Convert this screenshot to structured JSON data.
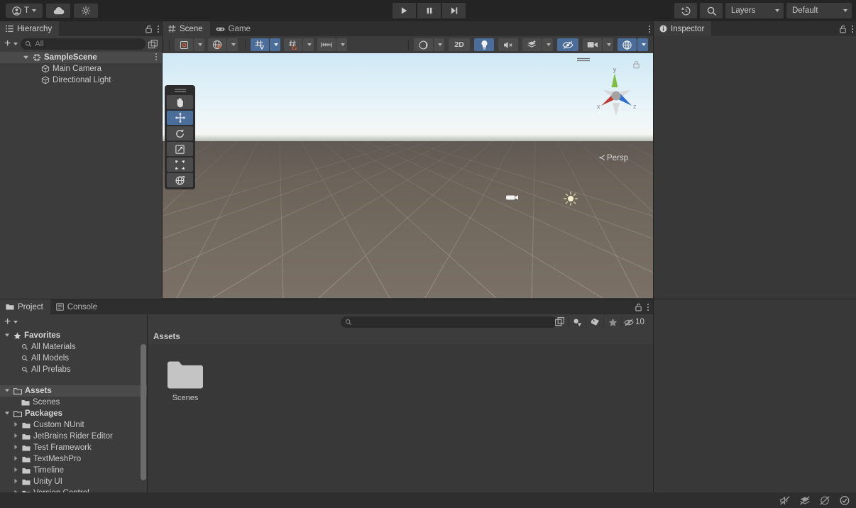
{
  "topbar": {
    "account_label": "T",
    "account_icon": "user-icon",
    "cloud_icon": "cloud-icon",
    "settings_icon": "settings-gear-icon",
    "play_icon": "play-icon",
    "pause_icon": "pause-icon",
    "step_icon": "step-icon",
    "history_icon": "undo-history-icon",
    "search_icon": "search-icon",
    "layers_label": "Layers",
    "default_label": "Default"
  },
  "hierarchy": {
    "tab_label": "Hierarchy",
    "tab_icon": "hierarchy-icon",
    "lock_icon": "lock-open-icon",
    "menu_icon": "kebab-menu-icon",
    "add_label": "+",
    "search_placeholder": "All",
    "search_icon": "search-icon",
    "expand_icon": "open-in-new-icon",
    "items": [
      {
        "label": "SampleScene",
        "icon": "scene-icon",
        "depth": 0,
        "expanded": true,
        "selected": true
      },
      {
        "label": "Main Camera",
        "icon": "gameobject-cube-icon",
        "depth": 1,
        "expanded": false,
        "selected": false
      },
      {
        "label": "Directional Light",
        "icon": "gameobject-cube-icon",
        "depth": 1,
        "expanded": false,
        "selected": false
      }
    ]
  },
  "scene": {
    "tabs": [
      {
        "label": "Scene",
        "icon": "scene-grid-icon",
        "active": true
      },
      {
        "label": "Game",
        "icon": "gamepad-icon",
        "active": false
      }
    ],
    "menu_icon": "kebab-menu-icon",
    "toolbar": {
      "pivot_icon": "pivot-center-icon",
      "handle_icon": "global-orientation-icon",
      "grid_snap_icon": "grid-snap-icon",
      "grid_visibility_icon": "grid-visibility-icon",
      "snap_increment_icon": "snap-increment-icon",
      "shading_icon": "shading-mode-icon",
      "twod_label": "2D",
      "lighting_icon": "light-bulb-icon",
      "audio_icon": "audio-mute-icon",
      "effects_icon": "fx-effects-icon",
      "hidden_icon": "hidden-objects-icon",
      "camera_icon": "scene-camera-icon",
      "gizmos_icon": "gizmos-icon"
    },
    "tools": [
      {
        "name": "hand-tool",
        "icon": "hand-icon",
        "active": false
      },
      {
        "name": "move-tool",
        "icon": "move-arrows-icon",
        "active": true
      },
      {
        "name": "rotate-tool",
        "icon": "rotate-icon",
        "active": false
      },
      {
        "name": "scale-tool",
        "icon": "scale-icon",
        "active": false
      },
      {
        "name": "rect-tool",
        "icon": "rect-transform-icon",
        "active": false
      },
      {
        "name": "transform-tool",
        "icon": "transform-globe-icon",
        "active": false
      }
    ],
    "gizmo": {
      "x_label": "x",
      "y_label": "y",
      "z_label": "z",
      "projection_label": "Persp",
      "lock_icon": "lock-closed-icon"
    },
    "objects": [
      {
        "name": "camera-gizmo",
        "label": "Main Camera"
      },
      {
        "name": "light-gizmo",
        "label": "Directional Light"
      }
    ]
  },
  "inspector": {
    "tab_label": "Inspector",
    "tab_icon": "info-icon",
    "lock_icon": "lock-open-icon",
    "menu_icon": "kebab-menu-icon"
  },
  "project": {
    "tabs": [
      {
        "label": "Project",
        "icon": "folder-icon",
        "active": true
      },
      {
        "label": "Console",
        "icon": "console-icon",
        "active": false
      }
    ],
    "lock_icon": "lock-open-icon",
    "menu_icon": "kebab-menu-icon",
    "add_label": "+",
    "search_placeholder": "",
    "search_icon": "search-icon",
    "save_search_icon": "save-search-icon",
    "filter_type_icon": "filter-by-type-icon",
    "filter_label_icon": "filter-by-label-icon",
    "favorites_filter_icon": "star-icon",
    "hidden_packages_icon": "hidden-packages-icon",
    "hidden_packages_count": "10",
    "tree": [
      {
        "label": "Favorites",
        "icon": "star-icon",
        "depth": 0,
        "expanded": true,
        "bold": true
      },
      {
        "label": "All Materials",
        "icon": "search-icon",
        "depth": 1,
        "bold": false
      },
      {
        "label": "All Models",
        "icon": "search-icon",
        "depth": 1,
        "bold": false
      },
      {
        "label": "All Prefabs",
        "icon": "search-icon",
        "depth": 1,
        "bold": false
      },
      {
        "label": "Assets",
        "icon": "folder-open-icon",
        "depth": 0,
        "expanded": true,
        "bold": true,
        "selected": true
      },
      {
        "label": "Scenes",
        "icon": "folder-icon",
        "depth": 1,
        "bold": false
      },
      {
        "label": "Packages",
        "icon": "folder-open-icon",
        "depth": 0,
        "expanded": true,
        "bold": true
      },
      {
        "label": "Custom NUnit",
        "icon": "folder-icon",
        "depth": 1,
        "collapsed": true
      },
      {
        "label": "JetBrains Rider Editor",
        "icon": "folder-icon",
        "depth": 1,
        "collapsed": true
      },
      {
        "label": "Test Framework",
        "icon": "folder-icon",
        "depth": 1,
        "collapsed": true
      },
      {
        "label": "TextMeshPro",
        "icon": "folder-icon",
        "depth": 1,
        "collapsed": true
      },
      {
        "label": "Timeline",
        "icon": "folder-icon",
        "depth": 1,
        "collapsed": true
      },
      {
        "label": "Unity UI",
        "icon": "folder-icon",
        "depth": 1,
        "collapsed": true
      },
      {
        "label": "Version Control",
        "icon": "folder-icon",
        "depth": 1,
        "collapsed": true
      }
    ],
    "breadcrumb": "Assets",
    "assets": [
      {
        "label": "Scenes",
        "icon": "folder-icon"
      }
    ]
  },
  "statusbar": {
    "icons": [
      "mute-audio-status-icon",
      "layers-status-icon",
      "visibility-status-icon",
      "check-circle-status-icon"
    ]
  },
  "colors": {
    "accent_blue": "#4a6d99",
    "panel_bg": "#383838",
    "toolbar_bg": "#3c3c3c",
    "window_bg": "#242424",
    "axis_x": "#c03a34",
    "axis_y": "#7fbf3f",
    "axis_z": "#2f6fd0"
  }
}
